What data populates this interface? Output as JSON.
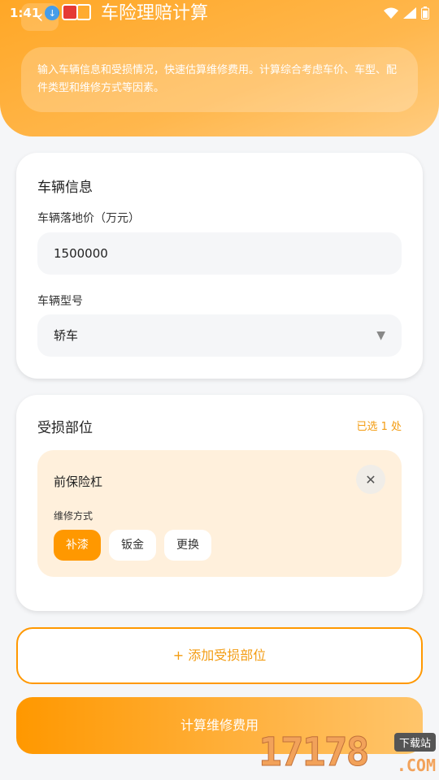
{
  "status_bar": {
    "time": "1:41"
  },
  "header": {
    "title": "车险理赔计算",
    "intro": "输入车辆信息和受损情况，快速估算维修费用。计算综合考虑车价、车型、配件类型和维修方式等因素。"
  },
  "vehicle_card": {
    "title": "车辆信息",
    "price_label": "车辆落地价（万元）",
    "price_value": "1500000",
    "model_label": "车辆型号",
    "model_value": "轿车"
  },
  "damage_card": {
    "title": "受损部位",
    "selected_count": "已选 1 处",
    "part": {
      "name": "前保险杠",
      "method_label": "维修方式",
      "methods": [
        "补漆",
        "钣金",
        "更换"
      ],
      "selected_method": "补漆"
    }
  },
  "actions": {
    "add_part": "+ 添加受损部位",
    "calculate": "计算维修费用"
  },
  "watermark": {
    "number": "17178",
    "tag": "下载站",
    "domain": ".COM"
  },
  "colors": {
    "accent": "#ff9800",
    "accent_text": "#f39c12",
    "part_bg": "#fff0dc"
  }
}
